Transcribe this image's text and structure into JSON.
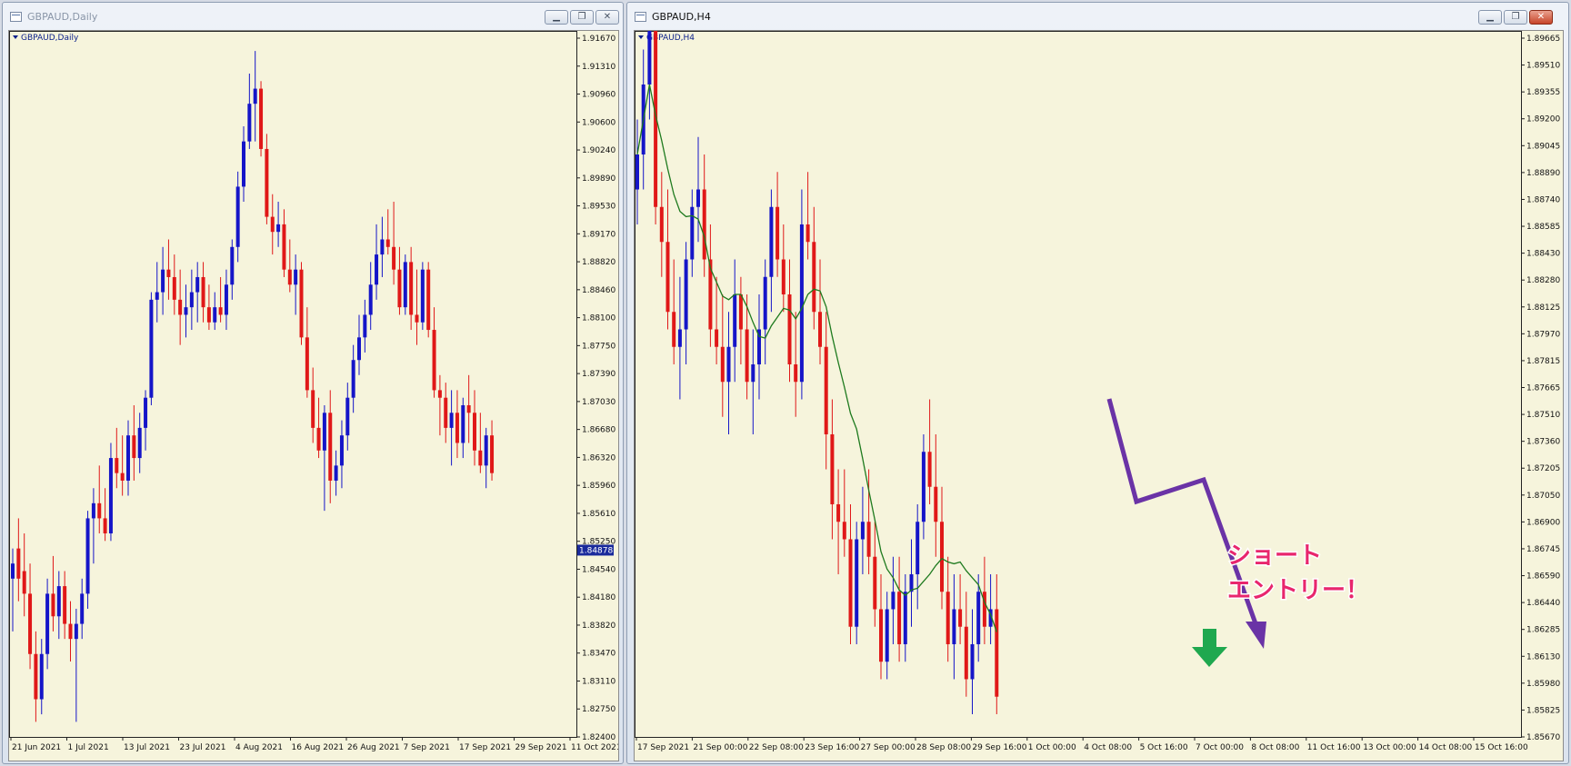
{
  "windows": [
    {
      "title": "GBPAUD,Daily",
      "chart_label": "GBPAUD,Daily",
      "state": "inactive",
      "chart_data": {
        "type": "candlestick",
        "symbol": "GBPAUD",
        "timeframe": "Daily",
        "ylim": [
          1.824,
          1.9167
        ],
        "y_ticks": [
          "1.91670",
          "1.91310",
          "1.90960",
          "1.90600",
          "1.90240",
          "1.89890",
          "1.89530",
          "1.89170",
          "1.88820",
          "1.88460",
          "1.88100",
          "1.87750",
          "1.87390",
          "1.87030",
          "1.86680",
          "1.86320",
          "1.85960",
          "1.85610",
          "1.85250",
          "1.84540",
          "1.84180",
          "1.83820",
          "1.83470",
          "1.83110",
          "1.82750",
          "1.82400"
        ],
        "x_ticks": [
          "21 Jun 2021",
          "1 Jul 2021",
          "13 Jul 2021",
          "23 Jul 2021",
          "4 Aug 2021",
          "16 Aug 2021",
          "26 Aug 2021",
          "7 Sep 2021",
          "17 Sep 2021",
          "29 Sep 2021",
          "11 Oct 2021"
        ],
        "current_price": "1.84878",
        "candles": [
          [
            1.845,
            1.849,
            1.838,
            1.847
          ],
          [
            1.849,
            1.853,
            1.842,
            1.845
          ],
          [
            1.846,
            1.851,
            1.84,
            1.843
          ],
          [
            1.843,
            1.847,
            1.833,
            1.835
          ],
          [
            1.835,
            1.838,
            1.826,
            1.829
          ],
          [
            1.829,
            1.837,
            1.827,
            1.835
          ],
          [
            1.835,
            1.845,
            1.833,
            1.843
          ],
          [
            1.843,
            1.848,
            1.838,
            1.84
          ],
          [
            1.84,
            1.846,
            1.837,
            1.844
          ],
          [
            1.844,
            1.846,
            1.837,
            1.839
          ],
          [
            1.839,
            1.842,
            1.834,
            1.837
          ],
          [
            1.837,
            1.841,
            1.826,
            1.839
          ],
          [
            1.839,
            1.845,
            1.837,
            1.843
          ],
          [
            1.843,
            1.854,
            1.841,
            1.853
          ],
          [
            1.853,
            1.857,
            1.847,
            1.855
          ],
          [
            1.855,
            1.86,
            1.851,
            1.853
          ],
          [
            1.853,
            1.857,
            1.85,
            1.851
          ],
          [
            1.851,
            1.863,
            1.85,
            1.861
          ],
          [
            1.861,
            1.865,
            1.857,
            1.859
          ],
          [
            1.859,
            1.864,
            1.856,
            1.858
          ],
          [
            1.858,
            1.866,
            1.856,
            1.864
          ],
          [
            1.864,
            1.868,
            1.858,
            1.861
          ],
          [
            1.861,
            1.867,
            1.859,
            1.865
          ],
          [
            1.865,
            1.87,
            1.862,
            1.869
          ],
          [
            1.869,
            1.883,
            1.868,
            1.882
          ],
          [
            1.882,
            1.887,
            1.879,
            1.883
          ],
          [
            1.883,
            1.889,
            1.88,
            1.886
          ],
          [
            1.886,
            1.89,
            1.882,
            1.885
          ],
          [
            1.885,
            1.888,
            1.88,
            1.882
          ],
          [
            1.882,
            1.886,
            1.876,
            1.88
          ],
          [
            1.88,
            1.884,
            1.877,
            1.881
          ],
          [
            1.881,
            1.886,
            1.878,
            1.883
          ],
          [
            1.883,
            1.887,
            1.879,
            1.885
          ],
          [
            1.885,
            1.887,
            1.879,
            1.881
          ],
          [
            1.881,
            1.884,
            1.878,
            1.879
          ],
          [
            1.879,
            1.883,
            1.878,
            1.881
          ],
          [
            1.881,
            1.885,
            1.879,
            1.88
          ],
          [
            1.88,
            1.886,
            1.878,
            1.884
          ],
          [
            1.884,
            1.89,
            1.882,
            1.889
          ],
          [
            1.889,
            1.899,
            1.887,
            1.897
          ],
          [
            1.897,
            1.905,
            1.895,
            1.903
          ],
          [
            1.903,
            1.912,
            1.902,
            1.908
          ],
          [
            1.908,
            1.915,
            1.903,
            1.91
          ],
          [
            1.91,
            1.911,
            1.901,
            1.902
          ],
          [
            1.902,
            1.904,
            1.892,
            1.893
          ],
          [
            1.893,
            1.896,
            1.888,
            1.891
          ],
          [
            1.891,
            1.895,
            1.889,
            1.892
          ],
          [
            1.892,
            1.894,
            1.885,
            1.886
          ],
          [
            1.886,
            1.89,
            1.883,
            1.884
          ],
          [
            1.884,
            1.888,
            1.88,
            1.886
          ],
          [
            1.886,
            1.887,
            1.876,
            1.877
          ],
          [
            1.877,
            1.881,
            1.869,
            1.87
          ],
          [
            1.87,
            1.873,
            1.863,
            1.865
          ],
          [
            1.865,
            1.869,
            1.861,
            1.862
          ],
          [
            1.862,
            1.868,
            1.854,
            1.867
          ],
          [
            1.867,
            1.87,
            1.855,
            1.858
          ],
          [
            1.858,
            1.862,
            1.856,
            1.86
          ],
          [
            1.86,
            1.866,
            1.857,
            1.864
          ],
          [
            1.864,
            1.871,
            1.862,
            1.869
          ],
          [
            1.869,
            1.876,
            1.867,
            1.874
          ],
          [
            1.874,
            1.88,
            1.872,
            1.877
          ],
          [
            1.877,
            1.882,
            1.875,
            1.88
          ],
          [
            1.88,
            1.887,
            1.878,
            1.884
          ],
          [
            1.884,
            1.892,
            1.882,
            1.888
          ],
          [
            1.888,
            1.893,
            1.885,
            1.89
          ],
          [
            1.89,
            1.894,
            1.888,
            1.889
          ],
          [
            1.889,
            1.895,
            1.884,
            1.886
          ],
          [
            1.886,
            1.889,
            1.88,
            1.881
          ],
          [
            1.881,
            1.888,
            1.88,
            1.887
          ],
          [
            1.887,
            1.889,
            1.878,
            1.88
          ],
          [
            1.88,
            1.886,
            1.876,
            1.879
          ],
          [
            1.879,
            1.887,
            1.878,
            1.886
          ],
          [
            1.886,
            1.887,
            1.877,
            1.878
          ],
          [
            1.878,
            1.881,
            1.869,
            1.87
          ],
          [
            1.87,
            1.872,
            1.864,
            1.869
          ],
          [
            1.869,
            1.871,
            1.863,
            1.865
          ],
          [
            1.865,
            1.87,
            1.86,
            1.867
          ],
          [
            1.867,
            1.87,
            1.861,
            1.863
          ],
          [
            1.863,
            1.869,
            1.861,
            1.868
          ],
          [
            1.868,
            1.872,
            1.863,
            1.867
          ],
          [
            1.867,
            1.87,
            1.86,
            1.862
          ],
          [
            1.862,
            1.867,
            1.859,
            1.86
          ],
          [
            1.86,
            1.865,
            1.857,
            1.864
          ],
          [
            1.864,
            1.866,
            1.858,
            1.859
          ]
        ]
      }
    },
    {
      "title": "GBPAUD,H4",
      "chart_label": "GBPAUD,H4",
      "state": "active",
      "chart_data": {
        "type": "candlestick",
        "symbol": "GBPAUD",
        "timeframe": "H4",
        "ylim": [
          1.8567,
          1.89665
        ],
        "y_ticks": [
          "1.89665",
          "1.89510",
          "1.89355",
          "1.89200",
          "1.89045",
          "1.88890",
          "1.88740",
          "1.88585",
          "1.88430",
          "1.88280",
          "1.88125",
          "1.87970",
          "1.87815",
          "1.87665",
          "1.87510",
          "1.87360",
          "1.87205",
          "1.87050",
          "1.86900",
          "1.86745",
          "1.86590",
          "1.86440",
          "1.86285",
          "1.86130",
          "1.85980",
          "1.85825",
          "1.85670"
        ],
        "x_ticks": [
          "17 Sep 2021",
          "21 Sep 00:00",
          "22 Sep 08:00",
          "23 Sep 16:00",
          "27 Sep 00:00",
          "28 Sep 08:00",
          "29 Sep 16:00",
          "1 Oct 00:00",
          "4 Oct 08:00",
          "5 Oct 16:00",
          "7 Oct 00:00",
          "8 Oct 08:00",
          "11 Oct 16:00",
          "13 Oct 00:00",
          "14 Oct 08:00",
          "15 Oct 16:00"
        ],
        "moving_average_color": "#1e7a1e",
        "candles": [
          [
            1.888,
            1.892,
            1.886,
            1.89
          ],
          [
            1.89,
            1.896,
            1.888,
            1.894
          ],
          [
            1.894,
            1.899,
            1.892,
            1.898
          ],
          [
            1.898,
            1.899,
            1.886,
            1.887
          ],
          [
            1.887,
            1.889,
            1.883,
            1.885
          ],
          [
            1.885,
            1.888,
            1.88,
            1.881
          ],
          [
            1.881,
            1.884,
            1.878,
            1.879
          ],
          [
            1.879,
            1.883,
            1.876,
            1.88
          ],
          [
            1.88,
            1.885,
            1.878,
            1.884
          ],
          [
            1.884,
            1.888,
            1.883,
            1.887
          ],
          [
            1.887,
            1.891,
            1.885,
            1.888
          ],
          [
            1.888,
            1.89,
            1.883,
            1.884
          ],
          [
            1.884,
            1.886,
            1.879,
            1.88
          ],
          [
            1.88,
            1.883,
            1.878,
            1.879
          ],
          [
            1.879,
            1.882,
            1.875,
            1.877
          ],
          [
            1.877,
            1.881,
            1.874,
            1.879
          ],
          [
            1.879,
            1.884,
            1.877,
            1.882
          ],
          [
            1.882,
            1.883,
            1.878,
            1.88
          ],
          [
            1.88,
            1.882,
            1.876,
            1.877
          ],
          [
            1.877,
            1.88,
            1.874,
            1.878
          ],
          [
            1.878,
            1.882,
            1.876,
            1.88
          ],
          [
            1.88,
            1.884,
            1.878,
            1.883
          ],
          [
            1.883,
            1.888,
            1.881,
            1.887
          ],
          [
            1.887,
            1.889,
            1.883,
            1.884
          ],
          [
            1.884,
            1.886,
            1.881,
            1.882
          ],
          [
            1.882,
            1.884,
            1.877,
            1.878
          ],
          [
            1.878,
            1.881,
            1.875,
            1.877
          ],
          [
            1.877,
            1.888,
            1.876,
            1.886
          ],
          [
            1.886,
            1.889,
            1.884,
            1.885
          ],
          [
            1.885,
            1.887,
            1.88,
            1.881
          ],
          [
            1.881,
            1.884,
            1.878,
            1.879
          ],
          [
            1.879,
            1.881,
            1.872,
            1.874
          ],
          [
            1.874,
            1.876,
            1.868,
            1.87
          ],
          [
            1.87,
            1.872,
            1.866,
            1.869
          ],
          [
            1.869,
            1.872,
            1.867,
            1.868
          ],
          [
            1.868,
            1.87,
            1.862,
            1.863
          ],
          [
            1.863,
            1.869,
            1.862,
            1.868
          ],
          [
            1.868,
            1.871,
            1.866,
            1.869
          ],
          [
            1.869,
            1.872,
            1.866,
            1.867
          ],
          [
            1.867,
            1.869,
            1.863,
            1.864
          ],
          [
            1.864,
            1.866,
            1.86,
            1.861
          ],
          [
            1.861,
            1.865,
            1.86,
            1.864
          ],
          [
            1.864,
            1.867,
            1.862,
            1.865
          ],
          [
            1.865,
            1.867,
            1.861,
            1.862
          ],
          [
            1.862,
            1.866,
            1.861,
            1.865
          ],
          [
            1.865,
            1.868,
            1.863,
            1.866
          ],
          [
            1.866,
            1.87,
            1.864,
            1.869
          ],
          [
            1.869,
            1.874,
            1.868,
            1.873
          ],
          [
            1.873,
            1.876,
            1.87,
            1.871
          ],
          [
            1.871,
            1.874,
            1.867,
            1.869
          ],
          [
            1.869,
            1.871,
            1.864,
            1.865
          ],
          [
            1.865,
            1.867,
            1.861,
            1.862
          ],
          [
            1.862,
            1.866,
            1.86,
            1.864
          ],
          [
            1.864,
            1.866,
            1.862,
            1.863
          ],
          [
            1.863,
            1.865,
            1.859,
            1.86
          ],
          [
            1.86,
            1.864,
            1.858,
            1.862
          ],
          [
            1.862,
            1.866,
            1.861,
            1.865
          ],
          [
            1.865,
            1.867,
            1.862,
            1.863
          ],
          [
            1.863,
            1.866,
            1.862,
            1.864
          ],
          [
            1.864,
            1.866,
            1.858,
            1.859
          ]
        ],
        "annotation": {
          "text_line1": "ショート",
          "text_line2": "エントリー！",
          "text_color": "#e8266d",
          "arrow_color": "#6a33a6",
          "entry_arrow_color": "#1fa84f"
        }
      }
    }
  ],
  "window_buttons": {
    "minimize_icon": "minimize-icon",
    "restore_icon": "restore-icon",
    "close_icon": "close-icon"
  }
}
